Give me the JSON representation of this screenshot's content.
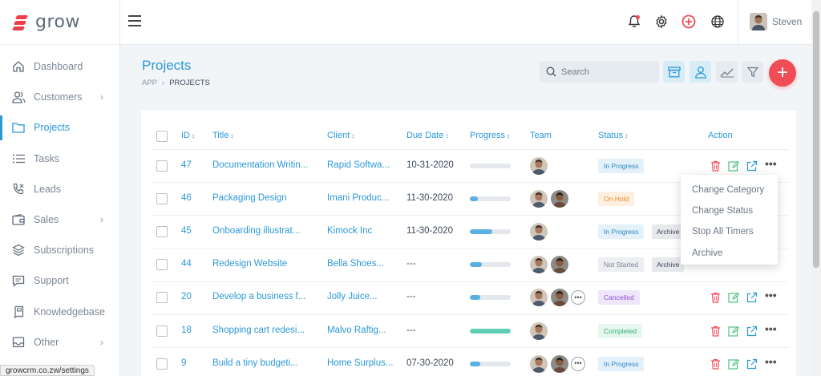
{
  "app": {
    "name": "grow"
  },
  "sidebar": {
    "items": [
      {
        "label": "Dashboard",
        "icon": "home-icon",
        "chevron": false,
        "active": false
      },
      {
        "label": "Customers",
        "icon": "users-icon",
        "chevron": true,
        "active": false
      },
      {
        "label": "Projects",
        "icon": "folder-icon",
        "chevron": false,
        "active": true
      },
      {
        "label": "Tasks",
        "icon": "list-icon",
        "chevron": false,
        "active": false
      },
      {
        "label": "Leads",
        "icon": "phone-icon",
        "chevron": false,
        "active": false
      },
      {
        "label": "Sales",
        "icon": "wallet-icon",
        "chevron": true,
        "active": false
      },
      {
        "label": "Subscriptions",
        "icon": "layers-icon",
        "chevron": false,
        "active": false
      },
      {
        "label": "Support",
        "icon": "chat-icon",
        "chevron": false,
        "active": false
      },
      {
        "label": "Knowledgebase",
        "icon": "book-icon",
        "chevron": false,
        "active": false
      },
      {
        "label": "Other",
        "icon": "box-icon",
        "chevron": true,
        "active": false
      }
    ]
  },
  "status_bar": {
    "url": "growcrm.co.zw/settings"
  },
  "topbar": {
    "user_name": "Steven"
  },
  "page": {
    "title": "Projects",
    "breadcrumb": [
      "APP",
      "PROJECTS"
    ],
    "search_placeholder": "Search"
  },
  "table": {
    "headers": {
      "id": "ID",
      "title": "Title",
      "client": "Client",
      "due_date": "Due Date",
      "progress": "Progress",
      "team": "Team",
      "status": "Status",
      "action": "Action"
    },
    "rows": [
      {
        "id": "47",
        "title": "Documentation Writin...",
        "client": "Rapid Softwa...",
        "due": "10-31-2020",
        "progress": 0,
        "team": 1,
        "team_more": false,
        "status": "In Progress",
        "status_kind": "progress",
        "archive": "",
        "actions": true
      },
      {
        "id": "46",
        "title": "Packaging Design",
        "client": "Imani Produc...",
        "due": "11-30-2020",
        "progress": 0.2,
        "team": 2,
        "team_more": false,
        "status": "On Hold",
        "status_kind": "hold",
        "archive": "",
        "actions": false
      },
      {
        "id": "45",
        "title": "Onboarding illustrat...",
        "client": "Kimock Inc",
        "due": "11-30-2020",
        "progress": 0.55,
        "team": 1,
        "team_more": false,
        "status": "In Progress",
        "status_kind": "progress",
        "archive": "Archive",
        "actions": false
      },
      {
        "id": "44",
        "title": "Redesign Website",
        "client": "Bella Shoes...",
        "due": "---",
        "progress": 0.3,
        "team": 2,
        "team_more": false,
        "status": "Not Started",
        "status_kind": "notstarted",
        "archive": "Archive",
        "actions": false
      },
      {
        "id": "20",
        "title": "Develop a business f...",
        "client": "Jolly Juice...",
        "due": "---",
        "progress": 0.25,
        "team": 2,
        "team_more": true,
        "status": "Cancelled",
        "status_kind": "cancelled",
        "archive": "",
        "actions": true
      },
      {
        "id": "18",
        "title": "Shopping cart redesi...",
        "client": "Malvo Raftig...",
        "due": "---",
        "progress": 1,
        "team": 1,
        "team_more": false,
        "status": "Completed",
        "status_kind": "completed",
        "archive": "",
        "actions": true
      },
      {
        "id": "9",
        "title": "Build a tiny budgeti...",
        "client": "Home Surplus...",
        "due": "07-30-2020",
        "progress": 0.25,
        "team": 2,
        "team_more": true,
        "status": "In Progress",
        "status_kind": "progress",
        "archive": "",
        "actions": true
      }
    ]
  },
  "dropdown": {
    "items": [
      "Change Category",
      "Change Status",
      "Stop All Timers",
      "Archive"
    ]
  },
  "colors": {
    "accent": "#2b98d6",
    "danger": "#f04d57",
    "sidebar_active": "#2b98d6"
  }
}
